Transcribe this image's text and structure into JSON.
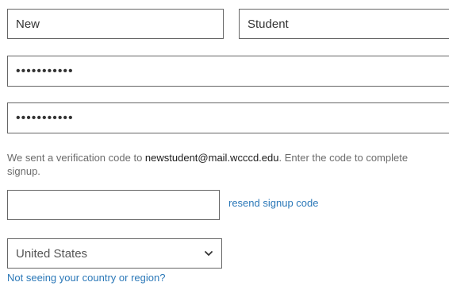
{
  "form": {
    "first_name": "New",
    "last_name": "Student",
    "password": "•••••••••••",
    "confirm_password": "•••••••••••",
    "verification": {
      "prefix": "We sent a verification code to ",
      "email": "newstudent@mail.wcccd.edu",
      "suffix": ". Enter the code to complete signup."
    },
    "code_value": "",
    "resend_label": "resend signup code",
    "country_value": "United States",
    "country_link": "Not seeing your country or region?"
  },
  "icons": {
    "country_dropdown": "chevron-down-icon"
  },
  "colors": {
    "link": "#2b78b8",
    "border": "#666666"
  }
}
